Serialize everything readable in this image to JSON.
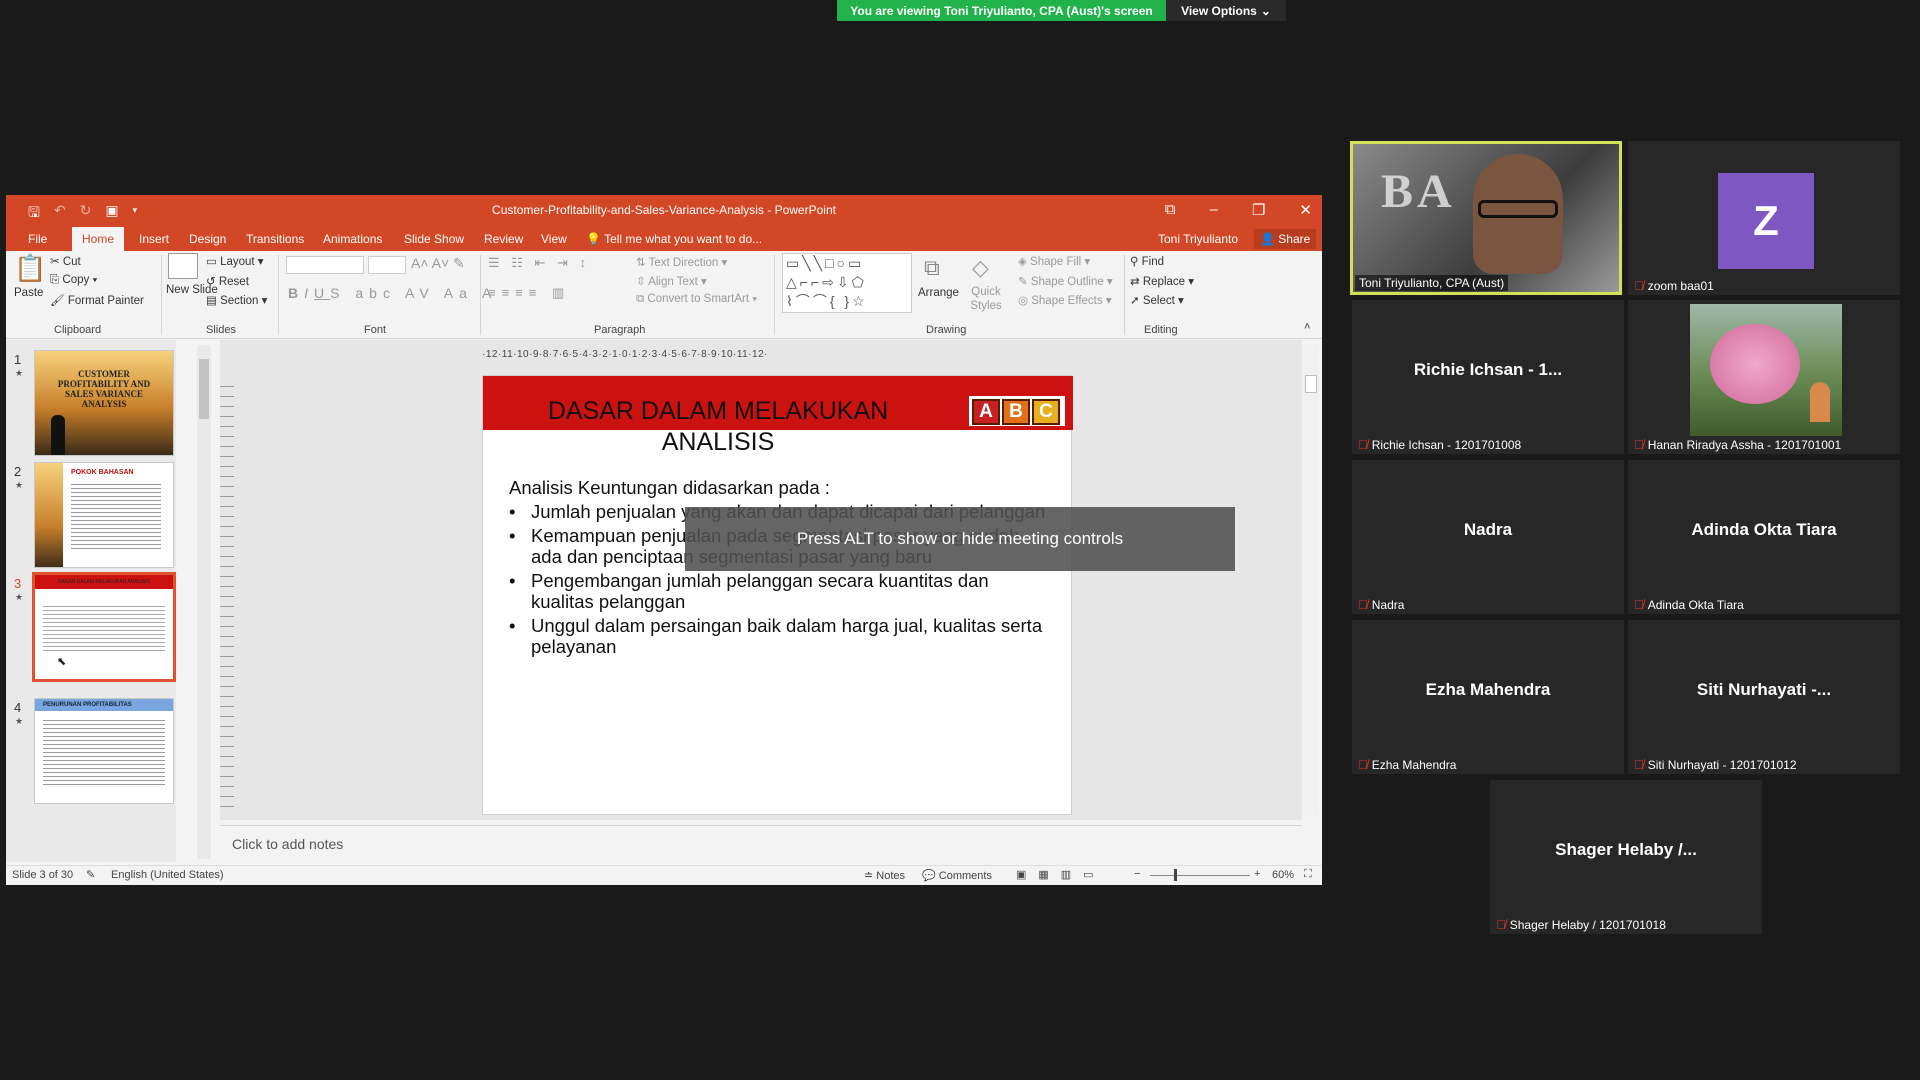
{
  "zoom": {
    "banner_text": "You are viewing Toni Triyulianto, CPA (Aust)'s screen",
    "view_options": "View Options",
    "alt_hint": "Press ALT to show or hide meeting controls"
  },
  "ppt": {
    "window_title": "Customer-Profitability-and-Sales-Variance-Analysis  -  PowerPoint",
    "tabs": [
      "File",
      "Home",
      "Insert",
      "Design",
      "Transitions",
      "Animations",
      "Slide Show",
      "Review",
      "View"
    ],
    "tell_me": "Tell me what you want to do...",
    "user": "Toni Triyulianto",
    "share": "Share",
    "clipboard": {
      "paste": "Paste",
      "cut": "Cut",
      "copy": "Copy",
      "format_painter": "Format Painter",
      "label": "Clipboard"
    },
    "slides_group": {
      "new_slide": "New Slide",
      "layout": "Layout",
      "reset": "Reset",
      "section": "Section",
      "label": "Slides"
    },
    "font_group": {
      "label": "Font"
    },
    "paragraph_group": {
      "text_direction": "Text Direction",
      "align_text": "Align Text",
      "convert": "Convert to SmartArt",
      "label": "Paragraph"
    },
    "drawing_group": {
      "arrange": "Arrange",
      "quick_styles": "Quick Styles",
      "shape_fill": "Shape Fill",
      "shape_outline": "Shape Outline",
      "shape_effects": "Shape Effects",
      "label": "Drawing"
    },
    "editing_group": {
      "find": "Find",
      "replace": "Replace",
      "select": "Select",
      "label": "Editing"
    },
    "thumbnails": [
      {
        "num": "1",
        "title": "CUSTOMER PROFITABILITY AND SALES VARIANCE ANALYSIS"
      },
      {
        "num": "2",
        "title": "POKOK BAHASAN"
      },
      {
        "num": "3",
        "title": "DASAR DALAM MELAKUKAN ANALISIS"
      },
      {
        "num": "4",
        "title": "PENURUNAN PROFITABILITAS"
      }
    ],
    "ruler": "·12·11·10·9·8·7·6·5·4·3·2·1·0·1·2·3·4·5·6·7·8·9·10·11·12·",
    "slide": {
      "title_line1": "DASAR DALAM MELAKUKAN",
      "title_line2": "ANALISIS",
      "abc": [
        "A",
        "B",
        "C"
      ],
      "intro": "Analisis Keuntungan didasarkan pada :",
      "bullets": [
        "Jumlah penjualan yang akan dan dapat dicapai dari pelanggan",
        "Kemampuan penjualan pada segmentasi pasar yang sudah ada dan penciptaan segmentasi pasar yang baru",
        "Pengembangan jumlah pelanggan secara kuantitas dan kualitas pelanggan",
        "Unggul dalam persaingan baik dalam harga jual, kualitas serta pelayanan"
      ]
    },
    "notes_placeholder": "Click to add notes",
    "status": {
      "slide": "Slide 3 of 30",
      "language": "English (United States)",
      "notes": "Notes",
      "comments": "Comments",
      "zoom": "60%"
    }
  },
  "participants": [
    {
      "name": "Toni Triyulianto, CPA (Aust)",
      "video": true
    },
    {
      "name": "zoom baa01",
      "avatar": "Z"
    },
    {
      "display": "Richie Ichsan - 1...",
      "name": "Richie Ichsan - 1201701008"
    },
    {
      "name": "Hanan Riradya Assha - 1201701001",
      "video": true
    },
    {
      "display": "Nadra",
      "name": "Nadra"
    },
    {
      "display": "Adinda Okta Tiara",
      "name": "Adinda Okta Tiara"
    },
    {
      "display": "Ezha Mahendra",
      "name": "Ezha Mahendra"
    },
    {
      "display": "Siti Nurhayati -...",
      "name": "Siti Nurhayati - 1201701012"
    },
    {
      "display": "Shager Helaby /...",
      "name": "Shager Helaby / 1201701018"
    }
  ],
  "colors": {
    "ppt_red": "#d24726",
    "zoom_green": "#22b24c",
    "speaker_border": "#d4e157",
    "avatar_purple": "#7e57c2"
  }
}
